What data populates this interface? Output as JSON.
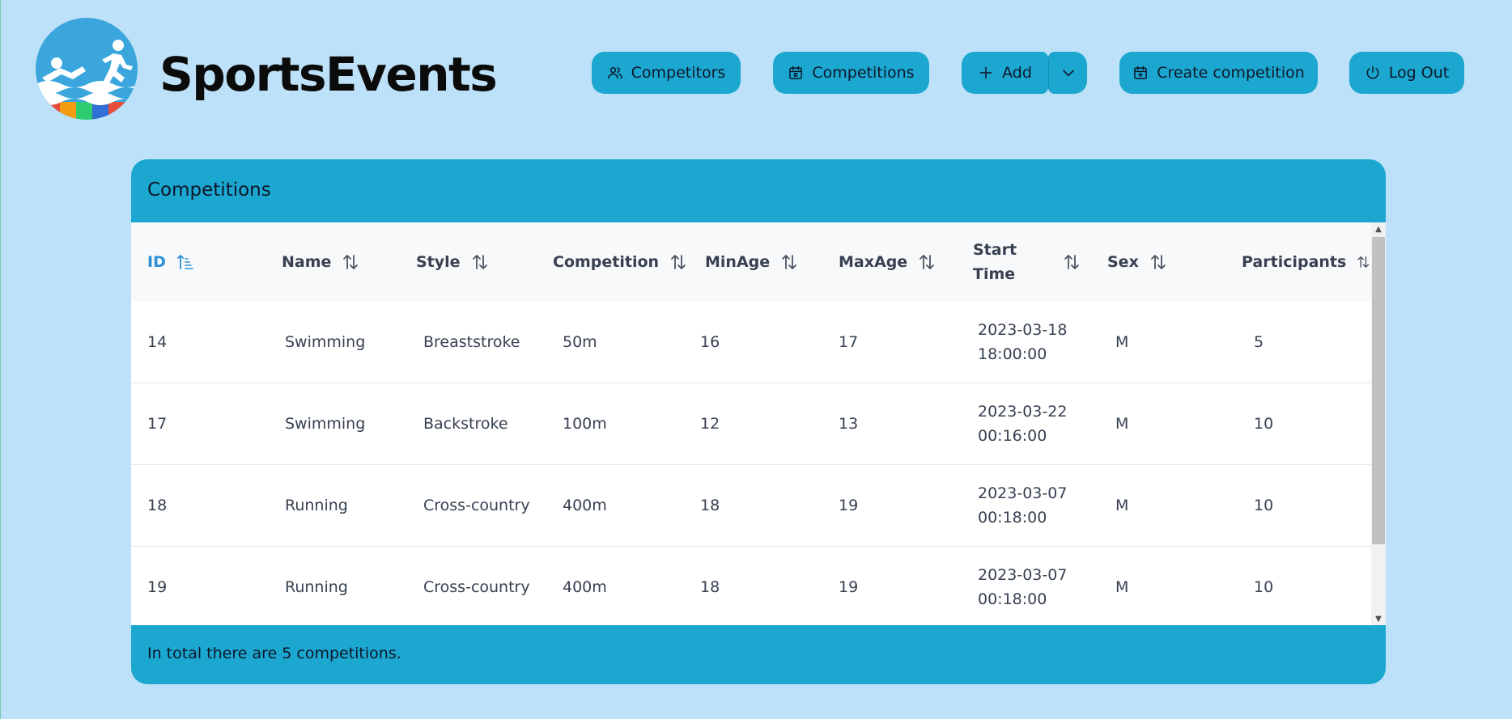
{
  "app": {
    "brand": "SportsEvents"
  },
  "nav": {
    "competitors": "Competitors",
    "competitions": "Competitions",
    "add": "Add",
    "create_competition": "Create competition",
    "logout": "Log Out"
  },
  "colors": {
    "background": "#bde1f8",
    "accent": "#1ba7d0",
    "active_sort": "#2b8fd6"
  },
  "table": {
    "title": "Competitions",
    "columns": [
      {
        "label": "ID",
        "sort": "ascending"
      },
      {
        "label": "Name",
        "sort": "none"
      },
      {
        "label": "Style",
        "sort": "none"
      },
      {
        "label": "Competition",
        "sort": "none"
      },
      {
        "label": "MinAge",
        "sort": "none"
      },
      {
        "label": "MaxAge",
        "sort": "none"
      },
      {
        "label": "Start\nTime",
        "sort": "none"
      },
      {
        "label": "Sex",
        "sort": "none"
      },
      {
        "label": "Participants",
        "sort": "none"
      }
    ],
    "rows": [
      [
        "14",
        "Swimming",
        "Breaststroke",
        "50m",
        "16",
        "17",
        "2023-03-18\n18:00:00",
        "M",
        "5"
      ],
      [
        "17",
        "Swimming",
        "Backstroke",
        "100m",
        "12",
        "13",
        "2023-03-22\n00:16:00",
        "M",
        "10"
      ],
      [
        "18",
        "Running",
        "Cross-country",
        "400m",
        "18",
        "19",
        "2023-03-07\n00:18:00",
        "M",
        "10"
      ],
      [
        "19",
        "Running",
        "Cross-country",
        "400m",
        "18",
        "19",
        "2023-03-07\n00:18:00",
        "M",
        "10"
      ]
    ],
    "footer": "In total there are 5 competitions."
  }
}
